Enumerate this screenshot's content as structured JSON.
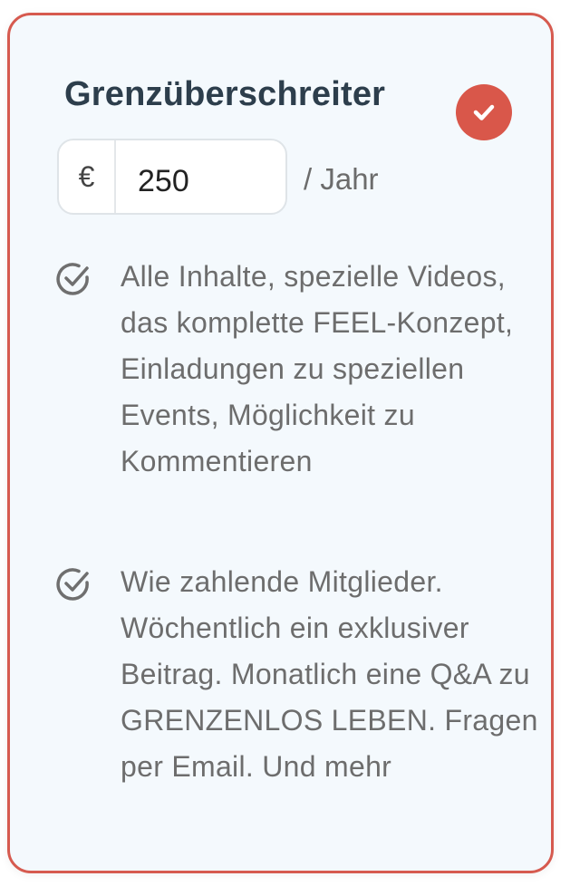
{
  "card": {
    "title": "Grenzüberschreiter",
    "selected": true,
    "accent_color": "#d9574a",
    "select_icon": "check-icon"
  },
  "price": {
    "currency": "€",
    "amount": "250",
    "period": "/ Jahr"
  },
  "features": [
    {
      "icon": "circle-check-icon",
      "text": "Alle Inhalte, spezielle Videos, das komplette FEEL-Konzept, Einladungen zu speziellen Events, Möglichkeit zu Kommentieren"
    },
    {
      "icon": "circle-check-icon",
      "text": "Wie zahlende Mitglieder. Wöchentlich ein exklusiver Beitrag. Monatlich eine Q&A zu GRENZENLOS LEBEN. Fragen per Email. Und mehr"
    }
  ]
}
